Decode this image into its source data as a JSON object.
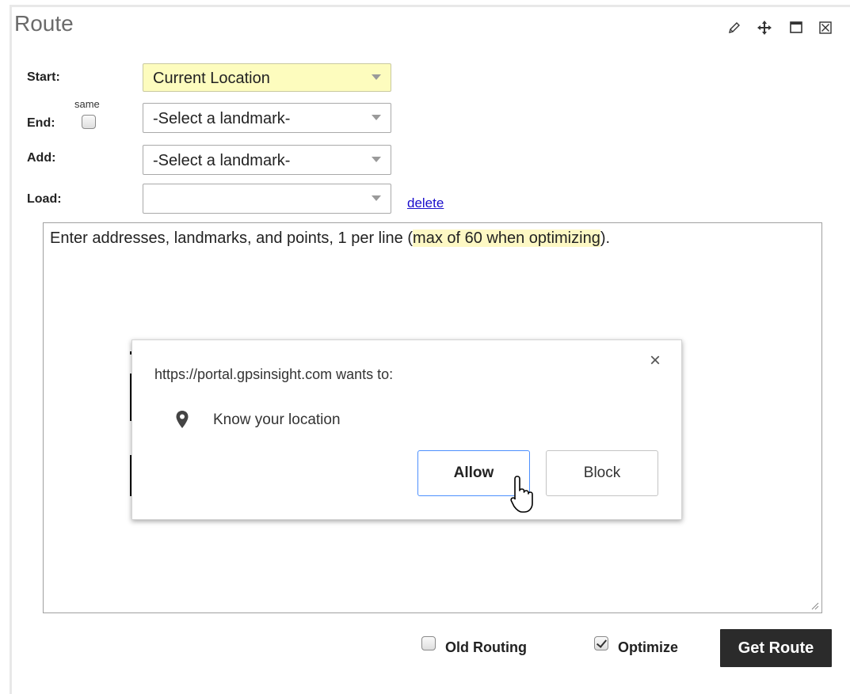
{
  "panel": {
    "title": "Route",
    "controls": {
      "edit_icon": "pencil-icon",
      "move_icon": "move-icon",
      "maximize_icon": "maximize-icon",
      "close_icon": "close-box-icon"
    }
  },
  "form": {
    "start": {
      "label": "Start:",
      "value": "Current Location"
    },
    "end": {
      "label": "End:",
      "same_label": "same",
      "same_checked": false,
      "value": "-Select a landmark-"
    },
    "add": {
      "label": "Add:",
      "value": "-Select a landmark-"
    },
    "load": {
      "label": "Load:",
      "value": "",
      "delete_link": "delete"
    }
  },
  "addresses": {
    "hint_prefix": "Enter addresses, landmarks, and points, 1 per line (",
    "hint_highlight": "max of 60 when optimizing",
    "hint_suffix": ")."
  },
  "permission_dialog": {
    "origin_text": "https://portal.gpsinsight.com wants to:",
    "permission_icon": "location-pin-icon",
    "permission_text": "Know your location",
    "allow_label": "Allow",
    "block_label": "Block",
    "close_glyph": "×"
  },
  "footer": {
    "old_routing_label": "Old Routing",
    "old_routing_checked": false,
    "optimize_label": "Optimize",
    "optimize_checked": true,
    "get_route_label": "Get Route"
  },
  "colors": {
    "start_select_bg": "#fdfcbe",
    "highlight_bg": "#fdf8c4",
    "link": "#1a0dcc",
    "button_dark": "#2b2b2b",
    "allow_border": "#4d90fe"
  }
}
